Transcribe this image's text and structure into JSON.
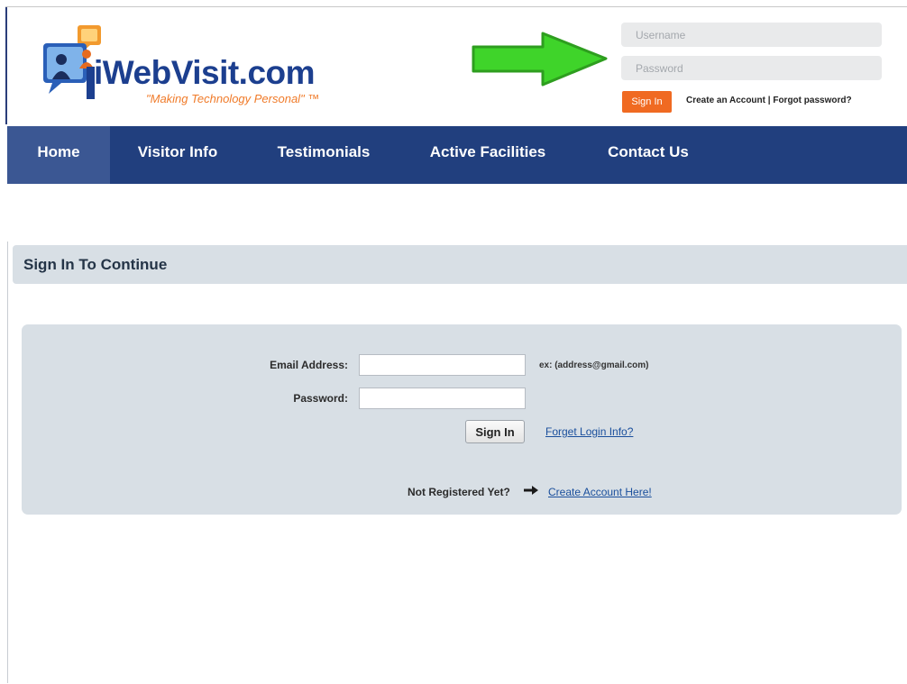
{
  "brand": {
    "name": "iWebVisit.com",
    "tagline": "\"Making Technology Personal\" ™"
  },
  "header_login": {
    "username_placeholder": "Username",
    "password_placeholder": "Password",
    "signin_label": "Sign In",
    "create_account_label": "Create an Account",
    "separator": " | ",
    "forgot_password_label": "Forgot password?"
  },
  "nav": {
    "items": [
      {
        "label": "Home",
        "active": true
      },
      {
        "label": "Visitor Info",
        "active": false
      },
      {
        "label": "Testimonials",
        "active": false
      },
      {
        "label": "Active Facilities",
        "active": false
      },
      {
        "label": "Contact Us",
        "active": false
      }
    ]
  },
  "section": {
    "title": "Sign In To Continue"
  },
  "form": {
    "email_label": "Email Address:",
    "email_value": "",
    "email_hint": "ex: (address@gmail.com)",
    "password_label": "Password:",
    "password_value": "",
    "signin_label": "Sign In",
    "forgot_link": "Forget Login Info?",
    "not_registered": "Not Registered Yet?",
    "create_account_link": "Create Account Here!"
  },
  "icons": [
    "green-arrow-icon",
    "logo-people-icon",
    "right-arrow-icon"
  ],
  "colors": {
    "nav_bg": "#213f7e",
    "nav_active": "#3b5793",
    "signin_orange": "#f06a22",
    "panel_bg": "#d8dfe5",
    "brand_blue": "#1c3f8f",
    "arrow_green": "#3fd42a"
  }
}
